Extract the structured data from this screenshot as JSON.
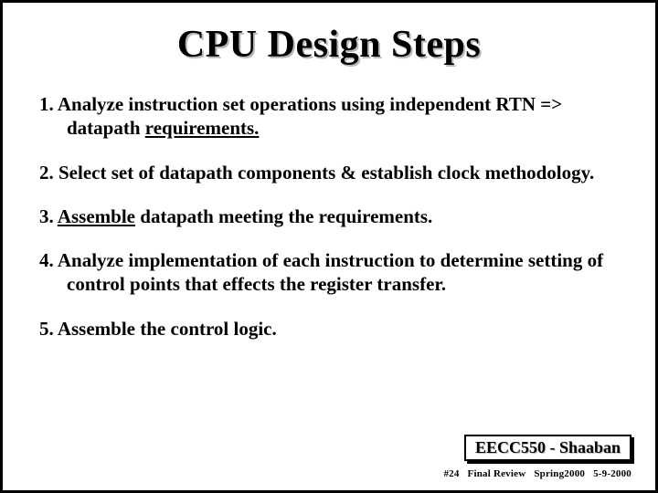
{
  "title": "CPU Design Steps",
  "steps": [
    {
      "num": "1.",
      "pre": "Analyze instruction set  operations using independent RTN  =>   datapath ",
      "u": "requirements.",
      "post": ""
    },
    {
      "num": "2.",
      "pre": "Select set of datapath components & establish clock methodology.",
      "u": "",
      "post": ""
    },
    {
      "num": "3.",
      "pre": "",
      "u": "Assemble",
      "post": " datapath meeting the requirements."
    },
    {
      "num": "4.",
      "pre": "Analyze implementation of each instruction to determine setting of control points that effects the register transfer.",
      "u": "",
      "post": ""
    },
    {
      "num": "5.",
      "pre": "Assemble the control logic.",
      "u": "",
      "post": ""
    }
  ],
  "footer": {
    "course": "EECC550 - Shaaban",
    "slide_no": "#24",
    "label": "Final Review",
    "term": "Spring2000",
    "date": "5-9-2000"
  }
}
